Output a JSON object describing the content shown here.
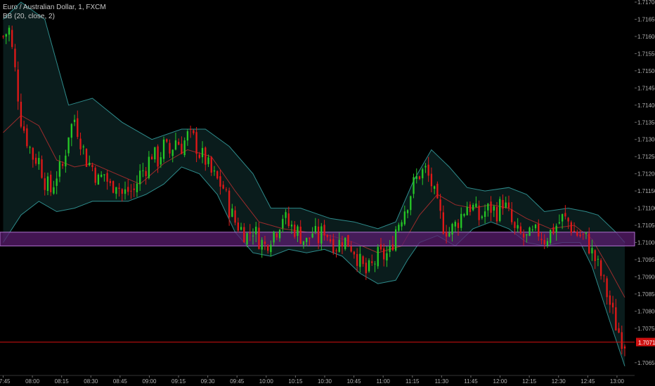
{
  "header": {
    "symbol_line": "Euro / Australian Dollar, 1, FXCM",
    "indicator_line": "BB (20, close, 2)"
  },
  "colors": {
    "background": "#000000",
    "axis_text": "#b0b0b0",
    "up_candle": "#26c726",
    "down_candle": "#e01818",
    "band_line": "#2e8b8b",
    "basis_line": "#9b2c2c",
    "band_fill": "#0a1c1c",
    "zone_fill": "#5a1c6e",
    "zone_border": "#b070d0",
    "price_line": "#d01010",
    "price_badge": "#d01010"
  },
  "chart_data": {
    "type": "candlestick",
    "symbol": "Euro / Australian Dollar",
    "interval": "1",
    "source": "FXCM",
    "indicator": {
      "name": "BB",
      "length": 20,
      "source": "close",
      "mult": 2
    },
    "y_axis": {
      "ylim": [
        1.7063,
        1.717
      ],
      "ticks": [
        "1.71700",
        "1.71650",
        "1.71600",
        "1.71550",
        "1.71500",
        "1.71450",
        "1.71400",
        "1.71350",
        "1.71300",
        "1.71250",
        "1.71200",
        "1.71150",
        "1.71100",
        "1.71050",
        "1.71000",
        "1.70950",
        "1.70900",
        "1.70850",
        "1.70800",
        "1.70750",
        "1.70700",
        "1.70650"
      ],
      "tick_values": [
        1.717,
        1.7165,
        1.716,
        1.7155,
        1.715,
        1.7145,
        1.714,
        1.7135,
        1.713,
        1.7125,
        1.712,
        1.7115,
        1.711,
        1.7105,
        1.71,
        1.7095,
        1.709,
        1.7085,
        1.708,
        1.7075,
        1.707,
        1.7065
      ]
    },
    "x_axis": {
      "start_time": "07:45",
      "end_time": "13:04",
      "ticks": [
        "07:45",
        "08:00",
        "08:15",
        "08:30",
        "08:45",
        "09:00",
        "09:15",
        "09:30",
        "09:45",
        "10:00",
        "10:15",
        "10:30",
        "10:45",
        "11:00",
        "11:15",
        "11:30",
        "11:45",
        "12:00",
        "12:15",
        "12:30",
        "12:45",
        "13:00"
      ],
      "tick_minutes": [
        0,
        15,
        30,
        45,
        60,
        75,
        90,
        105,
        120,
        135,
        150,
        165,
        180,
        195,
        210,
        225,
        240,
        255,
        270,
        285,
        300,
        315
      ]
    },
    "zone": {
      "low": 1.7099,
      "high": 1.7103
    },
    "last_price": {
      "value": 1.7071,
      "label": "1.70710"
    },
    "close_path": [
      [
        0,
        1.716
      ],
      [
        2,
        1.7162
      ],
      [
        4,
        1.715
      ],
      [
        6,
        1.7136
      ],
      [
        8,
        1.713
      ],
      [
        10,
        1.7125
      ],
      [
        12,
        1.7124
      ],
      [
        14,
        1.7118
      ],
      [
        16,
        1.7115
      ],
      [
        18,
        1.712
      ],
      [
        20,
        1.7122
      ],
      [
        22,
        1.7132
      ],
      [
        24,
        1.7136
      ],
      [
        26,
        1.713
      ],
      [
        28,
        1.7124
      ],
      [
        30,
        1.7122
      ],
      [
        32,
        1.7118
      ],
      [
        34,
        1.712
      ],
      [
        36,
        1.7116
      ],
      [
        38,
        1.7118
      ],
      [
        40,
        1.7114
      ],
      [
        42,
        1.7115
      ],
      [
        44,
        1.7115
      ],
      [
        46,
        1.712
      ],
      [
        48,
        1.7122
      ],
      [
        50,
        1.7126
      ],
      [
        52,
        1.7124
      ],
      [
        54,
        1.7128
      ],
      [
        56,
        1.7126
      ],
      [
        58,
        1.713
      ],
      [
        60,
        1.7128
      ],
      [
        62,
        1.7131
      ],
      [
        64,
        1.713
      ],
      [
        66,
        1.7126
      ],
      [
        68,
        1.7124
      ],
      [
        70,
        1.712
      ],
      [
        72,
        1.7118
      ],
      [
        74,
        1.7116
      ],
      [
        76,
        1.711
      ],
      [
        78,
        1.7106
      ],
      [
        80,
        1.7104
      ],
      [
        82,
        1.7102
      ],
      [
        84,
        1.7104
      ],
      [
        86,
        1.7101
      ],
      [
        88,
        1.7099
      ],
      [
        90,
        1.7102
      ],
      [
        92,
        1.7104
      ],
      [
        94,
        1.7108
      ],
      [
        96,
        1.7105
      ],
      [
        98,
        1.7104
      ],
      [
        100,
        1.7102
      ],
      [
        102,
        1.71
      ],
      [
        104,
        1.7103
      ],
      [
        106,
        1.7101
      ],
      [
        108,
        1.7104
      ],
      [
        110,
        1.7101
      ],
      [
        112,
        1.7099
      ],
      [
        114,
        1.7101
      ],
      [
        116,
        1.71
      ],
      [
        118,
        1.7098
      ],
      [
        120,
        1.7094
      ],
      [
        122,
        1.7091
      ],
      [
        124,
        1.7093
      ],
      [
        126,
        1.7096
      ],
      [
        128,
        1.7096
      ],
      [
        130,
        1.7097
      ],
      [
        132,
        1.7104
      ],
      [
        134,
        1.7108
      ],
      [
        136,
        1.7112
      ],
      [
        138,
        1.7117
      ],
      [
        140,
        1.712
      ],
      [
        142,
        1.7121
      ],
      [
        144,
        1.7117
      ],
      [
        146,
        1.711
      ],
      [
        148,
        1.7105
      ],
      [
        150,
        1.7103
      ],
      [
        152,
        1.7105
      ],
      [
        154,
        1.7108
      ],
      [
        156,
        1.7111
      ],
      [
        158,
        1.711
      ],
      [
        160,
        1.7107
      ],
      [
        162,
        1.7109
      ],
      [
        164,
        1.711
      ],
      [
        166,
        1.7109
      ],
      [
        168,
        1.7112
      ],
      [
        170,
        1.7108
      ],
      [
        172,
        1.7103
      ],
      [
        174,
        1.7102
      ],
      [
        176,
        1.7101
      ],
      [
        178,
        1.7102
      ],
      [
        180,
        1.7103
      ],
      [
        182,
        1.7101
      ],
      [
        184,
        1.7103
      ],
      [
        186,
        1.7105
      ],
      [
        188,
        1.7107
      ],
      [
        190,
        1.7106
      ],
      [
        192,
        1.7103
      ],
      [
        194,
        1.7102
      ],
      [
        196,
        1.7101
      ],
      [
        198,
        1.7097
      ],
      [
        200,
        1.7093
      ],
      [
        202,
        1.7088
      ],
      [
        204,
        1.7082
      ],
      [
        206,
        1.7076
      ],
      [
        208,
        1.7072
      ],
      [
        209,
        1.7071
      ]
    ],
    "upper_band": [
      [
        0,
        1.7165
      ],
      [
        6,
        1.717
      ],
      [
        14,
        1.7165
      ],
      [
        22,
        1.714
      ],
      [
        30,
        1.7142
      ],
      [
        40,
        1.7135
      ],
      [
        50,
        1.713
      ],
      [
        60,
        1.7133
      ],
      [
        68,
        1.7133
      ],
      [
        76,
        1.7128
      ],
      [
        84,
        1.712
      ],
      [
        90,
        1.711
      ],
      [
        100,
        1.711
      ],
      [
        110,
        1.7107
      ],
      [
        118,
        1.7106
      ],
      [
        126,
        1.7104
      ],
      [
        132,
        1.7106
      ],
      [
        138,
        1.7118
      ],
      [
        144,
        1.7127
      ],
      [
        150,
        1.7122
      ],
      [
        156,
        1.7116
      ],
      [
        162,
        1.7115
      ],
      [
        170,
        1.7116
      ],
      [
        176,
        1.7114
      ],
      [
        182,
        1.7109
      ],
      [
        190,
        1.711
      ],
      [
        196,
        1.7109
      ],
      [
        200,
        1.7108
      ],
      [
        206,
        1.7103
      ],
      [
        209,
        1.71
      ]
    ],
    "lower_band": [
      [
        0,
        1.71
      ],
      [
        6,
        1.7108
      ],
      [
        12,
        1.7112
      ],
      [
        18,
        1.7109
      ],
      [
        24,
        1.711
      ],
      [
        30,
        1.7112
      ],
      [
        36,
        1.7112
      ],
      [
        42,
        1.7112
      ],
      [
        48,
        1.7114
      ],
      [
        54,
        1.7117
      ],
      [
        60,
        1.7122
      ],
      [
        66,
        1.712
      ],
      [
        72,
        1.7114
      ],
      [
        78,
        1.7103
      ],
      [
        84,
        1.7097
      ],
      [
        90,
        1.7096
      ],
      [
        96,
        1.7098
      ],
      [
        102,
        1.7097
      ],
      [
        108,
        1.7098
      ],
      [
        114,
        1.7096
      ],
      [
        120,
        1.7091
      ],
      [
        126,
        1.7088
      ],
      [
        132,
        1.7089
      ],
      [
        136,
        1.7095
      ],
      [
        140,
        1.71
      ],
      [
        146,
        1.7102
      ],
      [
        152,
        1.7099
      ],
      [
        158,
        1.7104
      ],
      [
        164,
        1.7106
      ],
      [
        170,
        1.7104
      ],
      [
        176,
        1.71
      ],
      [
        182,
        1.7099
      ],
      [
        188,
        1.71
      ],
      [
        194,
        1.71
      ],
      [
        198,
        1.7093
      ],
      [
        204,
        1.7077
      ],
      [
        209,
        1.7064
      ]
    ],
    "basis": [
      [
        0,
        1.7132
      ],
      [
        6,
        1.7137
      ],
      [
        12,
        1.7134
      ],
      [
        18,
        1.7124
      ],
      [
        24,
        1.7122
      ],
      [
        30,
        1.7123
      ],
      [
        38,
        1.712
      ],
      [
        46,
        1.7117
      ],
      [
        54,
        1.7123
      ],
      [
        62,
        1.7127
      ],
      [
        70,
        1.7125
      ],
      [
        78,
        1.7115
      ],
      [
        86,
        1.7106
      ],
      [
        94,
        1.7104
      ],
      [
        102,
        1.7103
      ],
      [
        110,
        1.7102
      ],
      [
        118,
        1.71
      ],
      [
        126,
        1.7097
      ],
      [
        134,
        1.7099
      ],
      [
        140,
        1.7108
      ],
      [
        146,
        1.7114
      ],
      [
        152,
        1.7111
      ],
      [
        158,
        1.711
      ],
      [
        164,
        1.7111
      ],
      [
        170,
        1.711
      ],
      [
        176,
        1.7107
      ],
      [
        184,
        1.7104
      ],
      [
        192,
        1.7105
      ],
      [
        198,
        1.7101
      ],
      [
        204,
        1.7092
      ],
      [
        209,
        1.7084
      ]
    ]
  }
}
